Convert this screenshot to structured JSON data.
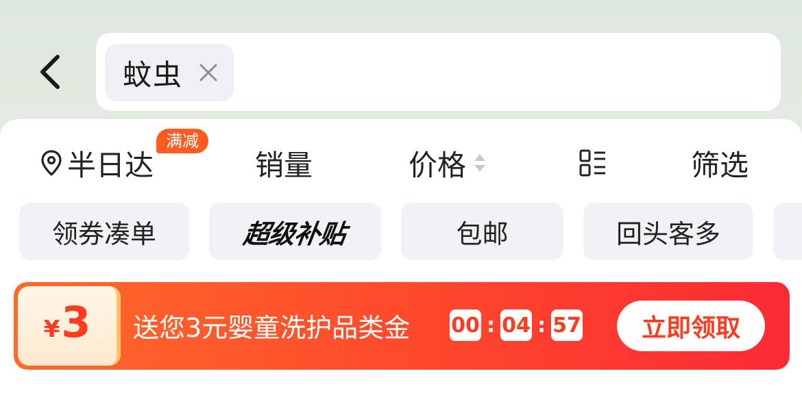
{
  "header": {
    "back_icon": "chevron-left-icon",
    "search_chip": {
      "text": "蚊虫",
      "close_icon": "close-icon"
    }
  },
  "tabs": [
    {
      "label": "半日达",
      "icon": "location-pin-icon",
      "badge": "满减"
    },
    {
      "label": "销量"
    },
    {
      "label": "价格",
      "icon": "sort-updown-icon"
    },
    {
      "icon": "list-layout-icon"
    },
    {
      "label": "筛选"
    }
  ],
  "quick_filters": [
    {
      "label": "领券凑单"
    },
    {
      "label": "超级补贴"
    },
    {
      "label": "包邮"
    },
    {
      "label": "回头客多"
    }
  ],
  "banner": {
    "coupon_currency": "¥",
    "coupon_amount": "3",
    "message": "送您3元婴童洗护品类金",
    "countdown": {
      "hours": "00",
      "minutes": "04",
      "seconds": "57"
    },
    "cta_label": "立即领取"
  },
  "colors": {
    "accent": "#ff3b1f",
    "badge": "#ff5a1f",
    "banner_start": "#ff6a2a",
    "banner_end": "#fa2a34"
  }
}
